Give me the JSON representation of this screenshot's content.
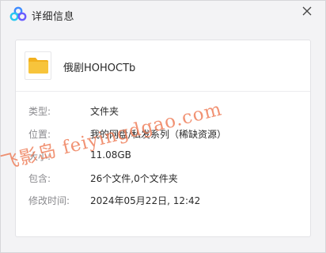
{
  "titlebar": {
    "title": "详细信息",
    "logo_icon": "cloud-logo-icon",
    "close_icon": "close-icon"
  },
  "file": {
    "name": "俄剧HOHOCTb",
    "icon": "folder-icon"
  },
  "details": [
    {
      "label": "类型:",
      "value": "文件夹"
    },
    {
      "label": "位置:",
      "value": "我的网盘/私发系列（稀缺资源）"
    },
    {
      "label": "大小:",
      "value": "11.08GB"
    },
    {
      "label": "包含:",
      "value": "26个文件,0个文件夹"
    },
    {
      "label": "修改时间:",
      "value": "2024年05月22日, 12:42"
    }
  ],
  "watermark": "飞影岛 feiyingdgao.com",
  "colors": {
    "folder": "#f7c43c",
    "watermark": "#ee7b55",
    "logo_blue": "#3f8cff",
    "logo_cyan": "#29c8f0"
  }
}
